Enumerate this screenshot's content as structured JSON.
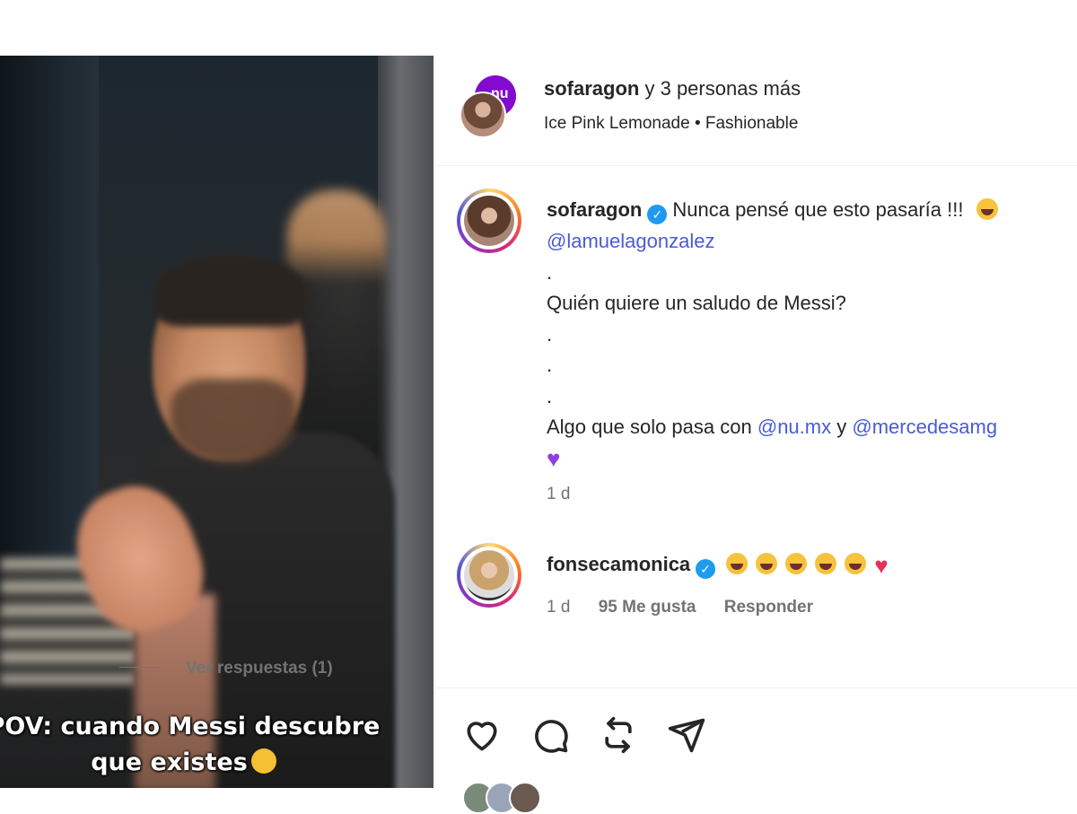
{
  "video": {
    "caption_line1": "POV: cuando Messi descubre",
    "caption_line2": "que existes"
  },
  "header": {
    "username": "sofaragon",
    "others": "y 3 personas más",
    "back_avatar_text": "nu",
    "music": "Ice Pink Lemonade • Fashionable"
  },
  "caption": {
    "username": "sofaragon",
    "text": "Nunca pensé que esto pasaría !!!",
    "mention1": "@lamuelagonzalez",
    "dot1": ".",
    "line2": "Quién quiere un saludo de Messi?",
    "dot2": ".",
    "dot3": ".",
    "dot4": ".",
    "line3_prefix": "Algo que solo pasa con",
    "mention2": "@nu.mx",
    "line3_and": "y",
    "mention3": "@mercedesamg",
    "time": "1 d"
  },
  "comment": {
    "username": "fonsecamonica",
    "time": "1 d",
    "likes": "95 Me gusta",
    "reply": "Responder",
    "view_replies": "Ver respuestas (1)"
  },
  "colors": {
    "mention": "#4a5bd5",
    "verified": "#1d9bf0",
    "nu_brand": "#820ad1",
    "muted": "#737373"
  },
  "icons": [
    "heart-icon",
    "comment-icon",
    "repost-icon",
    "share-icon",
    "verified-icon"
  ]
}
